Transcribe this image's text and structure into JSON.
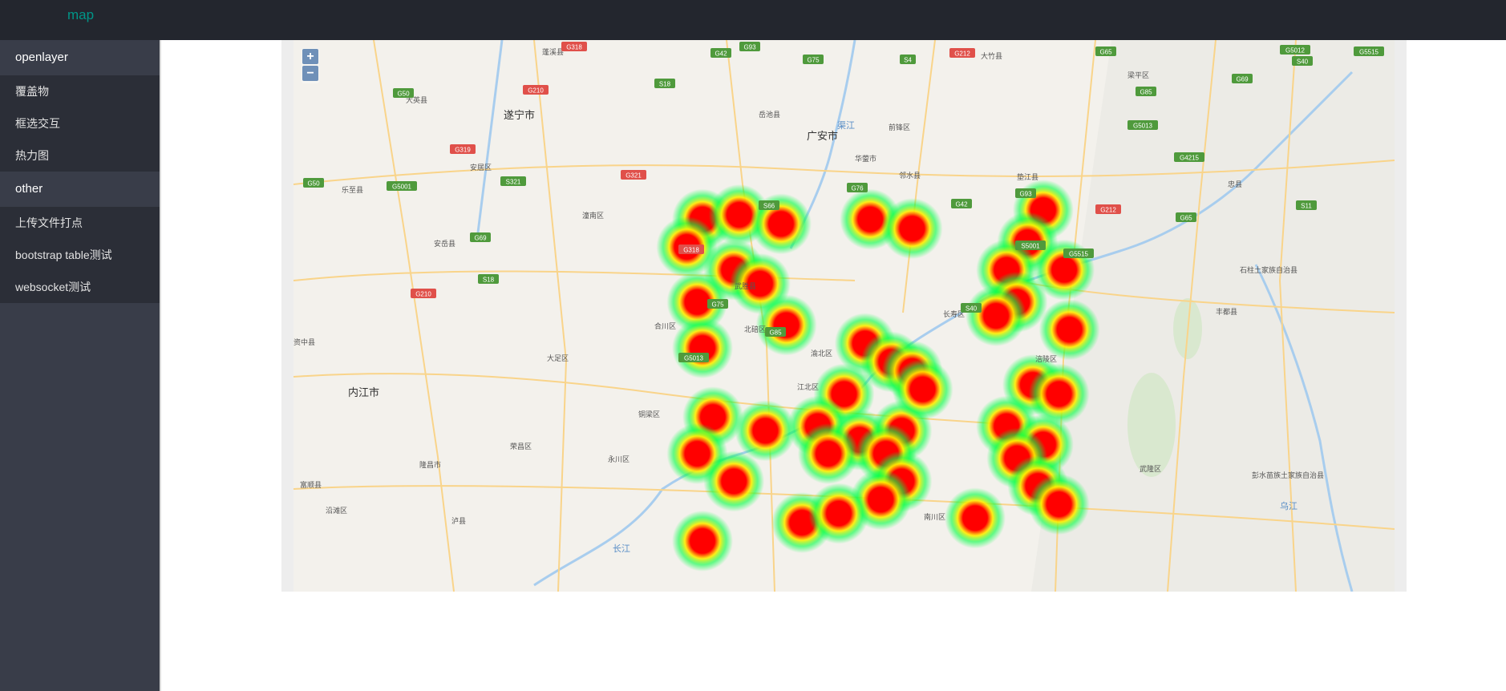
{
  "header": {
    "brand": "map"
  },
  "sidebar": {
    "sections": [
      {
        "title": "openlayer",
        "items": [
          "覆盖物",
          "框选交互",
          "热力图"
        ]
      },
      {
        "title": "other",
        "items": [
          "上传文件打点",
          "bootstrap table测试",
          "websocket测试"
        ]
      }
    ]
  },
  "map": {
    "controls": {
      "zoom_in": "+",
      "zoom_out": "−"
    },
    "cities": [
      "遂宁市",
      "广安市",
      "内江市"
    ],
    "places": [
      "蓬溪县",
      "大英县",
      "安居区",
      "乐至县",
      "安岳县",
      "潼南区",
      "岳池县",
      "华蓥市",
      "前锋区",
      "邻水县",
      "垫江县",
      "大竹县",
      "梁平区",
      "忠县",
      "石柱土家族自治县",
      "丰都县",
      "长寿区",
      "涪陵区",
      "武隆区",
      "南川区",
      "彭水苗族土家族自治县",
      "北碚区",
      "渝北区",
      "江北区",
      "大足区",
      "永川区",
      "荣昌区",
      "隆昌市",
      "富顺县",
      "泸县",
      "资中县",
      "沿滩区",
      "武胜县",
      "合川区",
      "铜梁区"
    ],
    "rivers": [
      "长江",
      "渠江",
      "乌江"
    ],
    "road_labels": [
      "G318",
      "G42",
      "G93",
      "G212",
      "G65",
      "G5012",
      "G5515",
      "G69",
      "G50",
      "G210",
      "S18",
      "G75",
      "G85",
      "S40",
      "G5013",
      "S11",
      "G319",
      "S321",
      "G321",
      "S66",
      "G76",
      "S4",
      "G4215",
      "S5001",
      "G5001"
    ],
    "heatmap": {
      "colors": {
        "hot": "#ff0000",
        "mid": "#ffee00",
        "cool": "#00ff44"
      },
      "points": [
        {
          "lon": 106.28,
          "lat": 30.01
        },
        {
          "lon": 106.35,
          "lat": 30.02
        },
        {
          "lon": 106.43,
          "lat": 30.0
        },
        {
          "lon": 106.6,
          "lat": 30.01
        },
        {
          "lon": 106.68,
          "lat": 29.99
        },
        {
          "lon": 106.93,
          "lat": 30.03
        },
        {
          "lon": 106.25,
          "lat": 29.95
        },
        {
          "lon": 106.9,
          "lat": 29.96
        },
        {
          "lon": 106.86,
          "lat": 29.9
        },
        {
          "lon": 106.97,
          "lat": 29.9
        },
        {
          "lon": 106.34,
          "lat": 29.9
        },
        {
          "lon": 106.39,
          "lat": 29.87
        },
        {
          "lon": 106.27,
          "lat": 29.83
        },
        {
          "lon": 106.88,
          "lat": 29.83
        },
        {
          "lon": 106.44,
          "lat": 29.78
        },
        {
          "lon": 106.84,
          "lat": 29.8
        },
        {
          "lon": 106.98,
          "lat": 29.77
        },
        {
          "lon": 106.28,
          "lat": 29.73
        },
        {
          "lon": 106.59,
          "lat": 29.74
        },
        {
          "lon": 106.64,
          "lat": 29.7
        },
        {
          "lon": 106.68,
          "lat": 29.68
        },
        {
          "lon": 106.55,
          "lat": 29.63
        },
        {
          "lon": 106.91,
          "lat": 29.65
        },
        {
          "lon": 106.96,
          "lat": 29.63
        },
        {
          "lon": 106.3,
          "lat": 29.58
        },
        {
          "lon": 106.4,
          "lat": 29.55
        },
        {
          "lon": 106.5,
          "lat": 29.56
        },
        {
          "lon": 106.58,
          "lat": 29.53
        },
        {
          "lon": 106.66,
          "lat": 29.55
        },
        {
          "lon": 106.27,
          "lat": 29.5
        },
        {
          "lon": 106.52,
          "lat": 29.5
        },
        {
          "lon": 106.63,
          "lat": 29.5
        },
        {
          "lon": 106.86,
          "lat": 29.56
        },
        {
          "lon": 106.93,
          "lat": 29.52
        },
        {
          "lon": 106.88,
          "lat": 29.49
        },
        {
          "lon": 106.34,
          "lat": 29.44
        },
        {
          "lon": 106.66,
          "lat": 29.44
        },
        {
          "lon": 106.62,
          "lat": 29.4
        },
        {
          "lon": 106.92,
          "lat": 29.43
        },
        {
          "lon": 106.96,
          "lat": 29.39
        },
        {
          "lon": 106.47,
          "lat": 29.35
        },
        {
          "lon": 106.54,
          "lat": 29.37
        },
        {
          "lon": 106.28,
          "lat": 29.31
        },
        {
          "lon": 106.8,
          "lat": 29.36
        },
        {
          "lon": 106.7,
          "lat": 29.64
        }
      ]
    }
  }
}
